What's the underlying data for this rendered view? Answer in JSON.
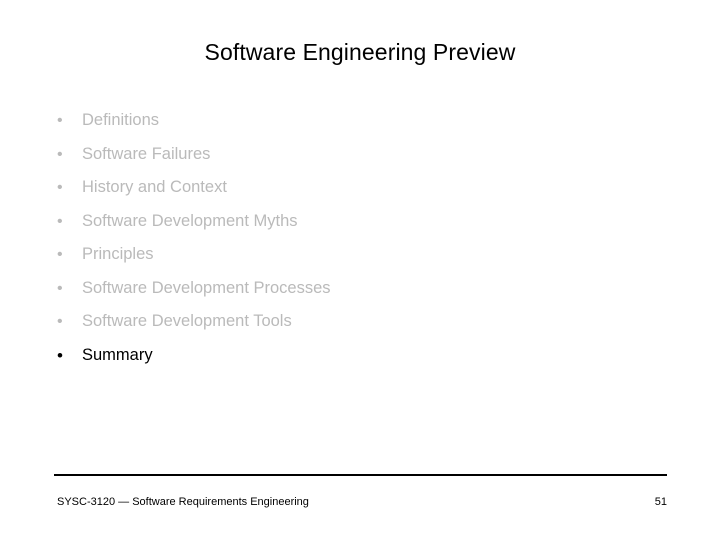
{
  "slide": {
    "title": "Software Engineering Preview",
    "page_number": "51",
    "colors": {
      "background": "#ffffff",
      "title_text": "#000000",
      "bullet_dimmed": "#bababa",
      "bullet_current": "#000000",
      "rule": "#000000"
    }
  },
  "outline": {
    "bullet_glyph": "•",
    "items": [
      {
        "label": "Definitions",
        "state": "dimmed"
      },
      {
        "label": "Software Failures",
        "state": "dimmed"
      },
      {
        "label": "History and Context",
        "state": "dimmed"
      },
      {
        "label": "Software Development Myths",
        "state": "dimmed"
      },
      {
        "label": "Principles",
        "state": "dimmed"
      },
      {
        "label": "Software Development Processes",
        "state": "dimmed"
      },
      {
        "label": "Software Development Tools",
        "state": "dimmed"
      },
      {
        "label": "Summary",
        "state": "current"
      }
    ]
  },
  "footer": {
    "course": "SYSC-3120 — Software Requirements Engineering",
    "page_number": "51"
  }
}
